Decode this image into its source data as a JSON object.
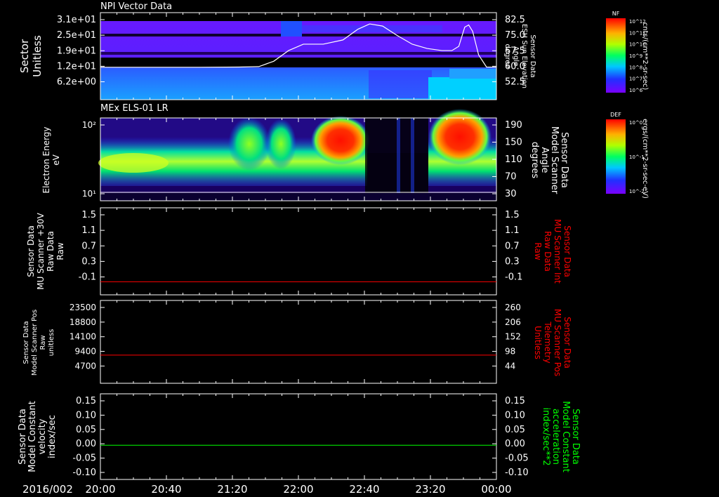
{
  "time_axis": {
    "date_label": "2016/002",
    "ticks": [
      "20:00",
      "20:40",
      "21:20",
      "22:00",
      "22:40",
      "23:20",
      "00:00"
    ],
    "range_hours": [
      20,
      24
    ]
  },
  "colors": {
    "white": "#ffffff",
    "red": "#ff0000",
    "green": "#00ff00",
    "bg": "#000000"
  },
  "colorbars": [
    {
      "label": "NF",
      "units": "cnts/(cm**2-sr-sec)",
      "ticks": [
        "10^12",
        "10^11",
        "10^10",
        "10^9",
        "10^8",
        "10^7",
        "10^6"
      ]
    },
    {
      "label": "DEF",
      "units": "ergs/(cm**2-sr-sec-eV)",
      "ticks": [
        "10^0",
        "10^-1",
        "10^-2"
      ]
    }
  ],
  "chart_data": [
    {
      "type": "heatmap",
      "title": "NPI Vector Data",
      "ylabel_left": [
        "Sector",
        "Unitless"
      ],
      "yticks_left": [
        "3.1e+01",
        "2.5e+01",
        "1.9e+01",
        "1.2e+01",
        "6.2e+00"
      ],
      "ylabel_right": [
        "Sensor Data",
        "ESH Sun Elevation",
        "Angle",
        "degree"
      ],
      "yticks_right": [
        "82.5",
        "75.0",
        "67.5",
        "60.0",
        "52.5"
      ],
      "overlay_line": {
        "color": "#ffffff",
        "x_hours": [
          20.0,
          21.0,
          21.4,
          21.6,
          21.75,
          21.9,
          22.05,
          22.25,
          22.45,
          22.6,
          22.72,
          22.85,
          23.0,
          23.15,
          23.3,
          23.45,
          23.55,
          23.62,
          23.68,
          23.72,
          23.76,
          23.82,
          23.9,
          24.0
        ],
        "y": [
          60.2,
          60.2,
          60.3,
          60.5,
          63,
          68,
          71,
          71,
          73,
          78,
          80.5,
          79.5,
          75,
          71,
          69,
          68,
          68,
          70,
          79,
          80,
          77,
          66,
          60.3,
          60.2
        ]
      }
    },
    {
      "type": "heatmap",
      "title": "MEx ELS-01 LR",
      "ylabel_left": [
        "Electron Energy",
        "eV"
      ],
      "yticks_left": [
        "10²",
        "10¹"
      ],
      "ylabel_right": [
        "Sensor Data",
        "Model Scanner",
        "Angle",
        "degrees"
      ],
      "yticks_right": [
        "190",
        "150",
        "110",
        "70",
        "30"
      ]
    },
    {
      "type": "line",
      "ylabel_left": [
        "Sensor Data",
        "MU Scanner +30V",
        "Raw Data",
        "Raw"
      ],
      "yticks_left": [
        "1.5",
        "1.1",
        "0.7",
        "0.3",
        "-0.1"
      ],
      "ylabel_right": [
        "Sensor Data",
        "MU Scanner Int",
        "Raw Data",
        "Raw"
      ],
      "yticks_right": [
        "1.5",
        "1.1",
        "0.7",
        "0.3",
        "-0.1"
      ],
      "ylim": [
        -0.3,
        1.5
      ],
      "series": [
        {
          "color": "#ff0000",
          "x_hours": [
            20,
            24
          ],
          "y": [
            -0.03,
            -0.03
          ]
        }
      ]
    },
    {
      "type": "line",
      "ylabel_left": [
        "Sensor Data",
        "Model Scanner Pos",
        "Raw",
        "unitless"
      ],
      "yticks_left": [
        "23500",
        "18800",
        "14100",
        "9400",
        "4700"
      ],
      "ylabel_right": [
        "Sensor Data",
        "MU Scanner Pos",
        "Telemetry",
        "Unitless"
      ],
      "yticks_right": [
        "260",
        "206",
        "152",
        "98",
        "44"
      ],
      "ylim": [
        0,
        23500
      ],
      "series": [
        {
          "color": "#ff0000",
          "x_hours": [
            20,
            24
          ],
          "y": [
            8000,
            8000
          ]
        }
      ]
    },
    {
      "type": "line",
      "ylabel_left": [
        "Sensor Data",
        "Model Constant",
        "velocity",
        "index/sec"
      ],
      "yticks_left": [
        "0.15",
        "0.10",
        "0.05",
        "0.00",
        "-0.05",
        "-0.10"
      ],
      "ylabel_right": [
        "Sensor Data",
        "Model Constant",
        "acceleration",
        "index/sec**2"
      ],
      "yticks_right": [
        "0.15",
        "0.10",
        "0.05",
        "0.00",
        "-0.05",
        "-0.10"
      ],
      "ylim": [
        -0.1,
        0.15
      ],
      "series": [
        {
          "color": "#00ff00",
          "x_hours": [
            20,
            24
          ],
          "y": [
            0,
            0
          ]
        }
      ]
    }
  ]
}
